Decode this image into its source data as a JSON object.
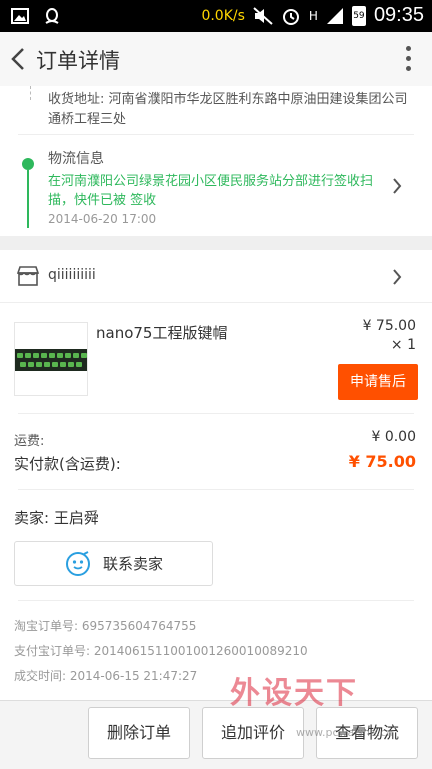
{
  "status_bar": {
    "speed": "0.0K/s",
    "signal": "H",
    "battery": "59",
    "time": "09:35"
  },
  "header": {
    "title": "订单详情"
  },
  "address": {
    "text": "收货地址: 河南省濮阳市华龙区胜利东路中原油田建设集团公司通桥工程三处"
  },
  "logistics": {
    "title": "物流信息",
    "latest": "在河南濮阳公司绿景花园小区便民服务站分部进行签收扫描，快件已被 签收",
    "date": "2014-06-20 17:00"
  },
  "shop": {
    "name": "qiiiiiiiiii",
    "item": {
      "name": "nano75工程版键帽",
      "price": "¥ 75.00",
      "qty": "× 1",
      "after_sale_label": "申请售后"
    },
    "shipping_label": "运费:",
    "shipping_value": "¥ 0.00",
    "paid_label": "实付款(含运费):",
    "paid_value": "¥ 75.00",
    "seller_label": "卖家:  王启舜",
    "contact_label": "联系卖家",
    "taobao_order": "淘宝订单号:  695735604764755",
    "alipay_order": "支付宝订单号:  2014061511001001260010089210",
    "deal_time": "成交时间:  2014-06-15 21:47:27"
  },
  "actions": {
    "delete": "删除订单",
    "review": "追加评价",
    "logistics": "查看物流"
  },
  "watermark": {
    "main": "外设天下",
    "url": "www.pcwaishe.cn"
  },
  "colors": {
    "accent": "#ff5000",
    "logistics_green": "#2eb85c"
  }
}
